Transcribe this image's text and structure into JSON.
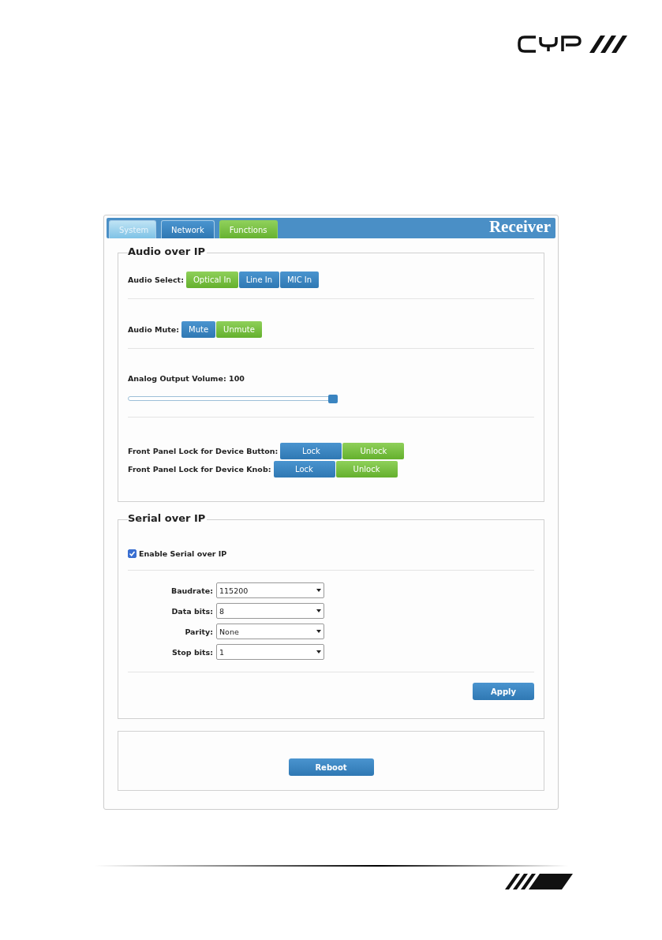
{
  "tabs": [
    {
      "label": "System",
      "selected": false
    },
    {
      "label": "Network",
      "selected": false
    },
    {
      "label": "Functions",
      "selected": true
    }
  ],
  "header_title": "Receiver",
  "audio_over_ip": {
    "legend": "Audio over IP",
    "audio_select": {
      "label": "Audio Select:",
      "options": [
        {
          "label": "Optical In",
          "selected": true
        },
        {
          "label": "Line In",
          "selected": false
        },
        {
          "label": "MIC In",
          "selected": false
        }
      ]
    },
    "audio_mute": {
      "label": "Audio Mute:",
      "options": [
        {
          "label": "Mute",
          "selected": false
        },
        {
          "label": "Unmute",
          "selected": true
        }
      ]
    },
    "volume": {
      "label": "Analog Output Volume: 100",
      "level": 1.0
    },
    "front_panel_locks": [
      {
        "label": "Front Panel Lock for Device Button:",
        "options": [
          {
            "label": "Lock",
            "selected": false
          },
          {
            "label": "Unlock",
            "selected": true
          }
        ]
      },
      {
        "label": "Front Panel Lock for Device Knob:",
        "options": [
          {
            "label": "Lock",
            "selected": false
          },
          {
            "label": "Unlock",
            "selected": true
          }
        ]
      }
    ]
  },
  "serial_over_ip": {
    "legend": "Serial over IP",
    "enable": {
      "label": "Enable Serial over IP",
      "checked": true
    },
    "fields": [
      {
        "label": "Baudrate:",
        "value": "115200"
      },
      {
        "label": "Data bits:",
        "value": "8"
      },
      {
        "label": "Parity:",
        "value": "None"
      },
      {
        "label": "Stop bits:",
        "value": "1"
      }
    ],
    "apply_button": "Apply"
  },
  "reboot_button": "Reboot"
}
